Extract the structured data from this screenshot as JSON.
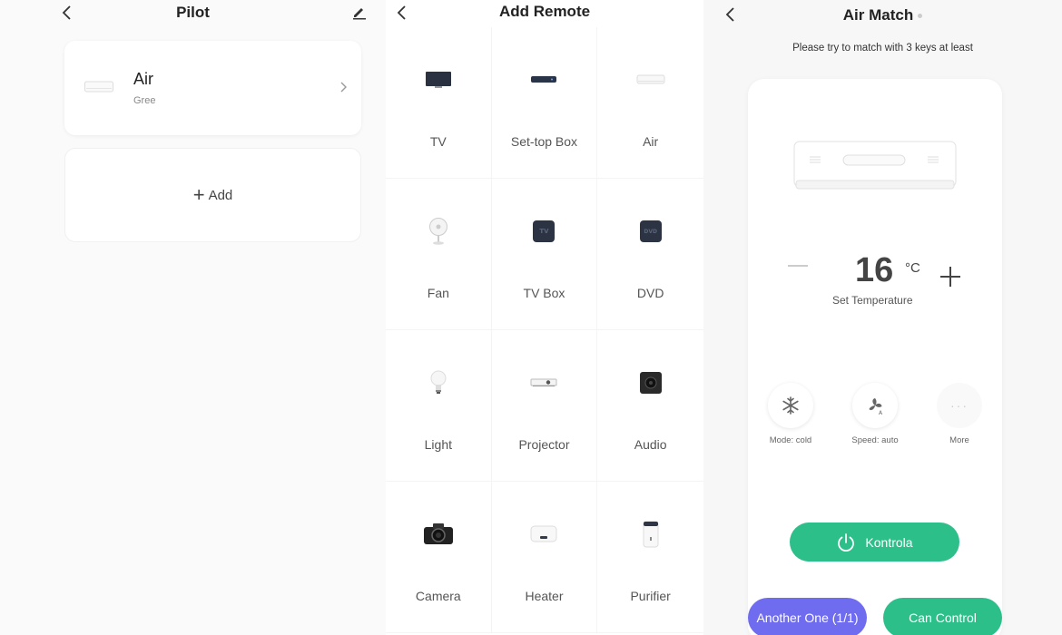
{
  "pilot": {
    "title": "Pilot",
    "device": {
      "name": "Air",
      "brand": "Gree"
    },
    "add_label": "Add"
  },
  "add_remote": {
    "title": "Add Remote",
    "items": [
      {
        "label": "TV",
        "icon": "tv-icon"
      },
      {
        "label": "Set-top Box",
        "icon": "set-top-box-icon"
      },
      {
        "label": "Air",
        "icon": "air-conditioner-icon"
      },
      {
        "label": "Fan",
        "icon": "fan-icon"
      },
      {
        "label": "TV Box",
        "icon": "tv-box-icon"
      },
      {
        "label": "DVD",
        "icon": "dvd-icon"
      },
      {
        "label": "Light",
        "icon": "light-bulb-icon"
      },
      {
        "label": "Projector",
        "icon": "projector-icon"
      },
      {
        "label": "Audio",
        "icon": "speaker-icon"
      },
      {
        "label": "Camera",
        "icon": "camera-icon"
      },
      {
        "label": "Heater",
        "icon": "heater-icon"
      },
      {
        "label": "Purifier",
        "icon": "purifier-icon"
      }
    ],
    "tv_box_glyph": "TV",
    "dvd_glyph": "DVD"
  },
  "air_match": {
    "title": "Air Match",
    "subtitle": "Please try to match with 3 keys at least",
    "temperature": "16",
    "unit": "°C",
    "temp_label": "Set Temperature",
    "modes": [
      {
        "label": "Mode: cold",
        "icon": "snowflake-icon"
      },
      {
        "label": "Speed: auto",
        "icon": "fan-auto-icon"
      },
      {
        "label": "More",
        "icon": "more-icon"
      }
    ],
    "kontrola_label": "Kontrola",
    "another_label": "Another One (1/1)",
    "can_control_label": "Can Control"
  },
  "colors": {
    "green": "#2cbf8a",
    "purple": "#6f6cf0"
  }
}
